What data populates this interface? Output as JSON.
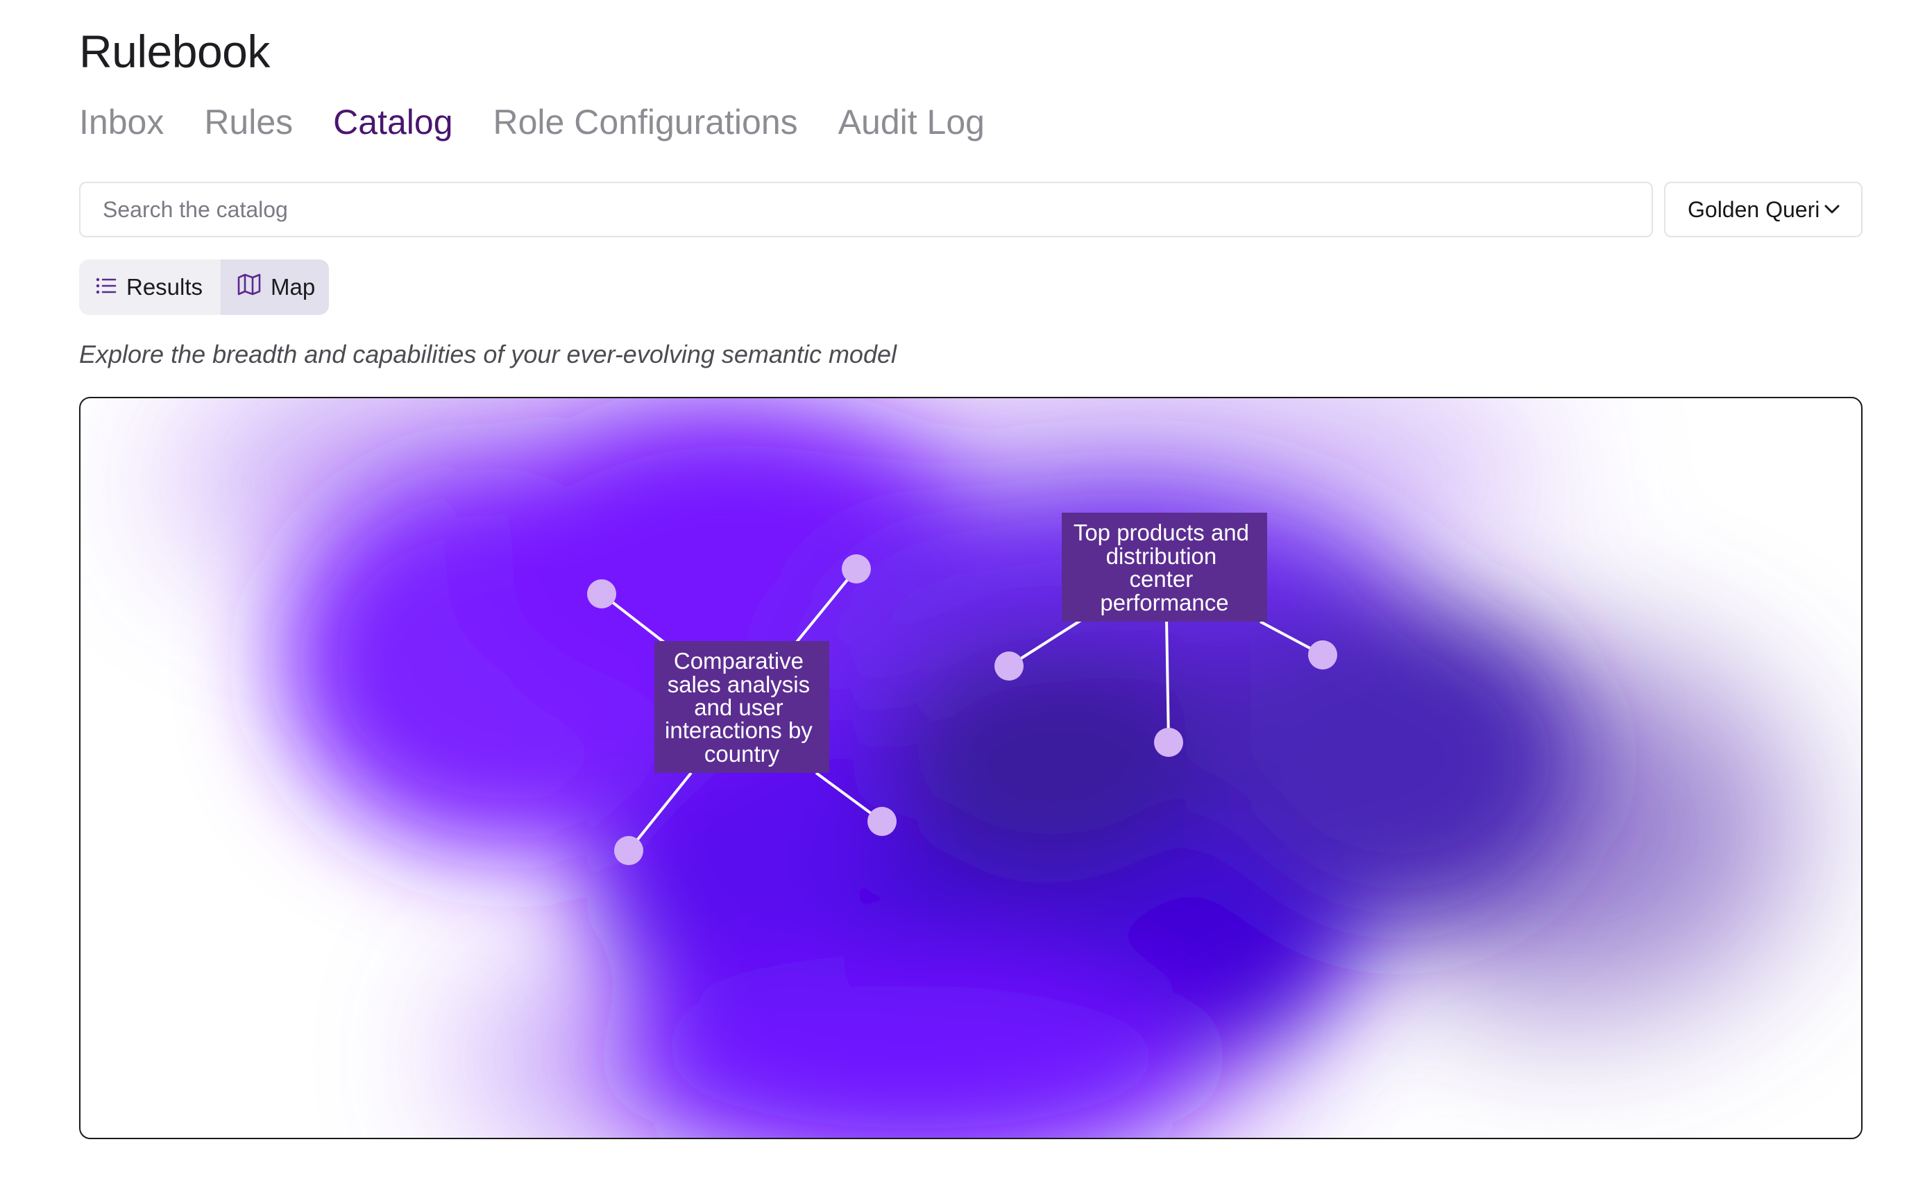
{
  "app": {
    "title": "Rulebook"
  },
  "nav": {
    "tabs": [
      {
        "label": "Inbox",
        "active": false
      },
      {
        "label": "Rules",
        "active": false
      },
      {
        "label": "Catalog",
        "active": true
      },
      {
        "label": "Role Configurations",
        "active": false
      },
      {
        "label": "Audit Log",
        "active": false
      }
    ]
  },
  "search": {
    "placeholder": "Search the catalog",
    "value": ""
  },
  "filter": {
    "selected": "Golden Queries",
    "icon": "chevron-down-icon"
  },
  "view_toggle": {
    "results_label": "Results",
    "results_icon": "list-icon",
    "map_label": "Map",
    "map_icon": "map-icon",
    "selected": "Map"
  },
  "map": {
    "subtitle": "Explore the breadth and capabilities of your ever-evolving semantic model",
    "clusters": [
      {
        "lines": [
          "Comparative",
          "sales analysis",
          "and user",
          "interactions by",
          "country"
        ]
      },
      {
        "lines": [
          "Top products and",
          "distribution",
          "center",
          "performance"
        ]
      }
    ]
  },
  "colors": {
    "accent": "#4a1570",
    "label_bg": "#5b2d91",
    "node": "#d5b4f5",
    "blob_violet": "#7b22ff",
    "blob_deep": "#4106d9"
  }
}
